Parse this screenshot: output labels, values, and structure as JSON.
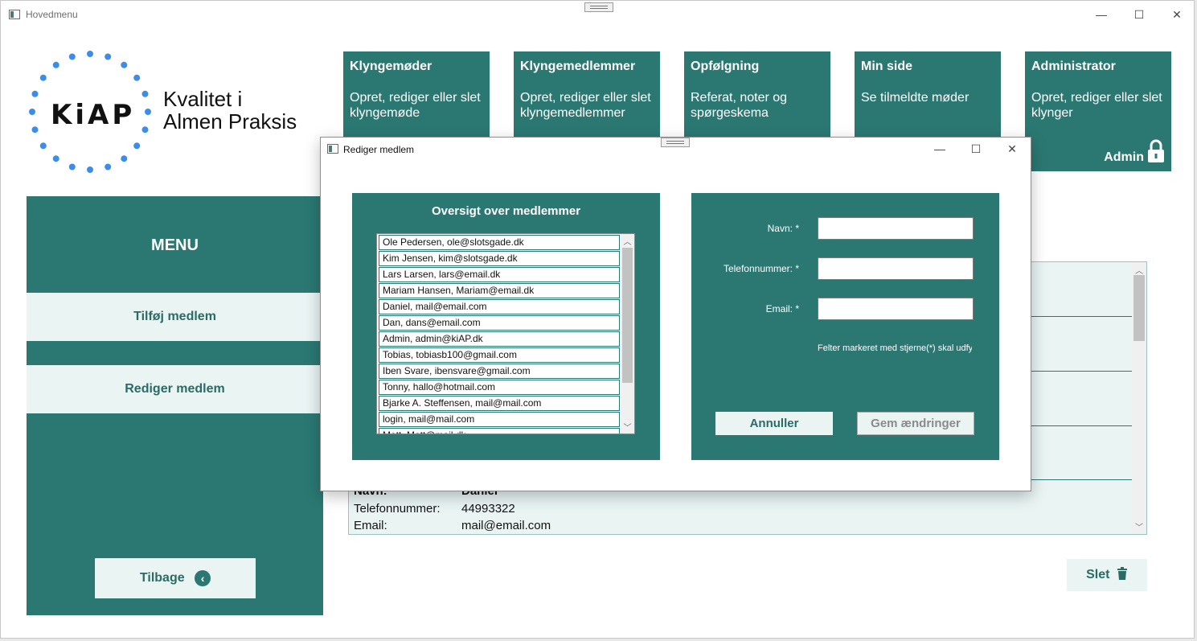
{
  "main_window": {
    "title": "Hovedmenu",
    "controls": {
      "minimize": "—",
      "maximize": "☐",
      "close": "✕"
    }
  },
  "logo": {
    "word": "KiAP",
    "tagline_line1": "Kvalitet i",
    "tagline_line2": "Almen Praksis"
  },
  "nav_tiles": [
    {
      "title": "Klyngemøder",
      "desc": "Opret, rediger eller slet klyngemøde"
    },
    {
      "title": "Klyngemedlemmer",
      "desc": "Opret, rediger eller slet klyngemedlemmer"
    },
    {
      "title": "Opfølgning",
      "desc": "Referat, noter og spørgeskema"
    },
    {
      "title": "Min side",
      "desc": "Se tilmeldte møder"
    },
    {
      "title": "Administrator",
      "desc": "Opret, rediger eller slet klynger",
      "badge": "Admin"
    }
  ],
  "menu": {
    "title": "MENU",
    "items": [
      {
        "label": "Tilføj medlem"
      },
      {
        "label": "Rediger medlem"
      }
    ],
    "back_label": "Tilbage"
  },
  "background_list": {
    "visible_record": {
      "name_label": "Navn:",
      "name_value": "Daniel",
      "phone_label": "Telefonnummer:",
      "phone_value": "44993322",
      "email_label": "Email:",
      "email_value": "mail@email.com"
    }
  },
  "delete_label": "Slet",
  "dialog": {
    "title": "Rediger medlem",
    "controls": {
      "minimize": "—",
      "maximize": "☐",
      "close": "✕"
    },
    "overview_title": "Oversigt over medlemmer",
    "members": [
      "Ole Pedersen, ole@slotsgade.dk",
      "Kim Jensen, kim@slotsgade.dk",
      "Lars Larsen, lars@email.dk",
      "Mariam Hansen, Mariam@email.dk",
      "Daniel, mail@email.com",
      "Dan, dans@email.com",
      "Admin, admin@kiAP.dk",
      "Tobias, tobiasb100@gmail.com",
      "Iben Svare, ibensvare@gmail.com",
      "Tonny, hallo@hotmail.com",
      "Bjarke A. Steffensen, mail@mail.com",
      "login, mail@mail.com",
      "Matt, Matt@mail.dk"
    ],
    "form": {
      "name_label": "Navn: *",
      "name_value": "",
      "phone_label": "Telefonnummer: *",
      "phone_value": "",
      "email_label": "Email: *",
      "email_value": "",
      "required_note": "Felter markeret med stjerne(*) skal udfyldes",
      "cancel_label": "Annuller",
      "save_label": "Gem ændringer"
    }
  },
  "colors": {
    "teal": "#2b7873",
    "light": "#e9f4f3",
    "logo_dots": "#3d8de8"
  }
}
